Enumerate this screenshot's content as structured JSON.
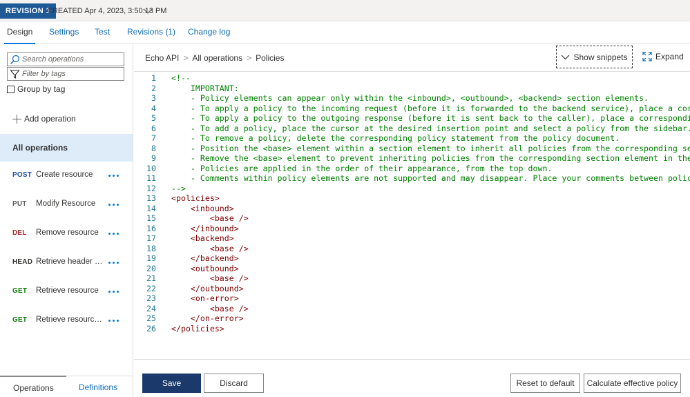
{
  "revision": {
    "badge": "REVISION 1",
    "created": "CREATED Apr 4, 2023, 3:50:13 PM"
  },
  "tabs": [
    "Design",
    "Settings",
    "Test",
    "Revisions (1)",
    "Change log"
  ],
  "left": {
    "search_placeholder": "Search operations",
    "filter_placeholder": "Filter by tags",
    "group_by_tag": "Group by tag",
    "add_operation": "Add operation",
    "all_operations": "All operations",
    "operations": [
      {
        "method": "POST",
        "name": "Create resource",
        "color": "#1f4e9c"
      },
      {
        "method": "PUT",
        "name": "Modify Resource",
        "color": "#605e5c"
      },
      {
        "method": "DEL",
        "name": "Remove resource",
        "color": "#a4262c"
      },
      {
        "method": "HEAD",
        "name": "Retrieve header o...",
        "color": "#323130"
      },
      {
        "method": "GET",
        "name": "Retrieve resource",
        "color": "#107c10"
      },
      {
        "method": "GET",
        "name": "Retrieve resource...",
        "color": "#107c10"
      }
    ],
    "bottom_tabs": {
      "operations": "Operations",
      "definitions": "Definitions"
    }
  },
  "breadcrumb": [
    "Echo API",
    "All operations",
    "Policies"
  ],
  "toolbar": {
    "show_snippets": "Show snippets",
    "expand": "Expand"
  },
  "code_lines": [
    {
      "n": "1",
      "text": "<!--",
      "cls": "c-com"
    },
    {
      "n": "2",
      "text": "    IMPORTANT:",
      "cls": "c-com"
    },
    {
      "n": "3",
      "text": "    - Policy elements can appear only within the <inbound>, <outbound>, <backend> section elements.",
      "cls": "c-com"
    },
    {
      "n": "4",
      "text": "    - To apply a policy to the incoming request (before it is forwarded to the backend service), place a correspond",
      "cls": "c-com"
    },
    {
      "n": "5",
      "text": "    - To apply a policy to the outgoing response (before it is sent back to the caller), place a corresponding poli",
      "cls": "c-com"
    },
    {
      "n": "6",
      "text": "    - To add a policy, place the cursor at the desired insertion point and select a policy from the sidebar.",
      "cls": "c-com"
    },
    {
      "n": "7",
      "text": "    - To remove a policy, delete the corresponding policy statement from the policy document.",
      "cls": "c-com"
    },
    {
      "n": "8",
      "text": "    - Position the <base> element within a section element to inherit all policies from the corresponding section e",
      "cls": "c-com"
    },
    {
      "n": "9",
      "text": "    - Remove the <base> element to prevent inheriting policies from the corresponding section element in the enclos",
      "cls": "c-com"
    },
    {
      "n": "10",
      "text": "    - Policies are applied in the order of their appearance, from the top down.",
      "cls": "c-com"
    },
    {
      "n": "11",
      "text": "    - Comments within policy elements are not supported and may disappear. Place your comments between policy eleme",
      "cls": "c-com"
    },
    {
      "n": "12",
      "text": "-->",
      "cls": "c-com"
    },
    {
      "n": "13",
      "text": "<policies>",
      "cls": "c-tag"
    },
    {
      "n": "14",
      "text": "    <inbound>",
      "cls": "c-tag"
    },
    {
      "n": "15",
      "text": "        <base />",
      "cls": "c-base"
    },
    {
      "n": "16",
      "text": "    </inbound>",
      "cls": "c-tag"
    },
    {
      "n": "17",
      "text": "    <backend>",
      "cls": "c-tag"
    },
    {
      "n": "18",
      "text": "        <base />",
      "cls": "c-base"
    },
    {
      "n": "19",
      "text": "    </backend>",
      "cls": "c-tag"
    },
    {
      "n": "20",
      "text": "    <outbound>",
      "cls": "c-tag"
    },
    {
      "n": "21",
      "text": "        <base />",
      "cls": "c-base"
    },
    {
      "n": "22",
      "text": "    </outbound>",
      "cls": "c-tag"
    },
    {
      "n": "23",
      "text": "    <on-error>",
      "cls": "c-tag"
    },
    {
      "n": "24",
      "text": "        <base />",
      "cls": "c-base"
    },
    {
      "n": "25",
      "text": "    </on-error>",
      "cls": "c-tag"
    },
    {
      "n": "26",
      "text": "</policies>",
      "cls": "c-tag"
    }
  ],
  "buttons": {
    "save": "Save",
    "discard": "Discard",
    "reset": "Reset to default",
    "calculate": "Calculate effective policy"
  },
  "colors": {
    "accent": "#0078d4",
    "primary_button": "#1b3a6b",
    "revision_badge": "#1f5a96",
    "selected_row": "#deecf9"
  }
}
